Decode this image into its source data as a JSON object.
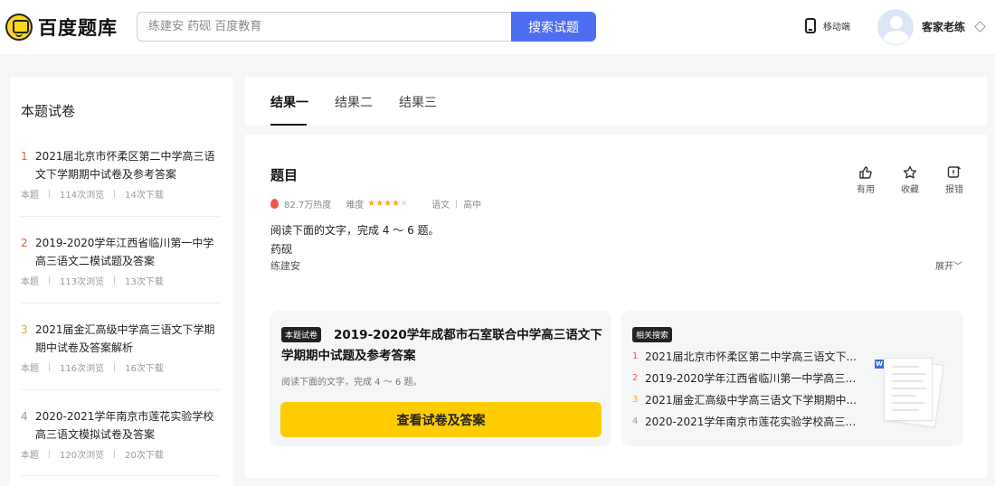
{
  "header": {
    "logo_text": "百度题库",
    "search_placeholder": "练建安 药砚 百度教育",
    "search_button": "搜索试题",
    "mobile_label": "移动端",
    "username": "客家老练"
  },
  "sidebar": {
    "title": "本题试卷",
    "items": [
      {
        "num": "1",
        "num_color": "#f0564a",
        "name": "2021届北京市怀柔区第二中学高三语文下学期期中试卷及参考答案",
        "type": "本题",
        "views": "114次浏览",
        "downloads": "14次下载"
      },
      {
        "num": "2",
        "num_color": "#f0564a",
        "name": "2019-2020学年江西省临川第一中学高三语文二模试题及答案",
        "type": "本题",
        "views": "113次浏览",
        "downloads": "13次下载"
      },
      {
        "num": "3",
        "num_color": "#f5a623",
        "name": "2021届金汇高级中学高三语文下学期期中试卷及答案解析",
        "type": "本题",
        "views": "116次浏览",
        "downloads": "16次下载"
      },
      {
        "num": "4",
        "num_color": "#999999",
        "name": "2020-2021学年南京市莲花实验学校高三语文模拟试卷及答案",
        "type": "本题",
        "views": "120次浏览",
        "downloads": "20次下载"
      }
    ]
  },
  "tabs": [
    {
      "label": "结果一"
    },
    {
      "label": "结果二"
    },
    {
      "label": "结果三"
    }
  ],
  "question": {
    "title": "题目",
    "heat": "82.7万热度",
    "difficulty_label": "难度",
    "difficulty_rating": 4,
    "difficulty_max": 5,
    "subject": "语文",
    "level": "高中",
    "body_line1": "阅读下面的文字，完成 4 ～ 6 题。",
    "body_line2": "药砚",
    "author": "练建安",
    "expand": "展开",
    "actions": [
      {
        "label": "有用",
        "icon": "thumbs-up-icon"
      },
      {
        "label": "收藏",
        "icon": "star-icon"
      },
      {
        "label": "报错",
        "icon": "report-icon"
      }
    ]
  },
  "paper_box": {
    "tag": "本题试卷",
    "title": "2019-2020学年成都市石室联合中学高三语文下学期期中试题及参考答案",
    "desc": "阅读下面的文字，完成 4 ～ 6 题。",
    "button": "查看试卷及答案"
  },
  "related": {
    "tag": "相关搜索",
    "items": [
      {
        "num": "1",
        "num_color": "#f0564a",
        "text": "2021届北京市怀柔区第二中学高三语文下..."
      },
      {
        "num": "2",
        "num_color": "#f0564a",
        "text": "2019-2020学年江西省临川第一中学高三语..."
      },
      {
        "num": "3",
        "num_color": "#f5a623",
        "text": "2021届金汇高级中学高三语文下学期期中..."
      },
      {
        "num": "4",
        "num_color": "#999999",
        "text": "2020-2021学年南京市莲花实验学校高三语..."
      }
    ],
    "doc_badge": "W"
  },
  "colors": {
    "accent_blue": "#4e6ef2",
    "button_yellow": "#ffcc00",
    "star_orange": "#f5a623",
    "hot_red": "#f0564a"
  }
}
